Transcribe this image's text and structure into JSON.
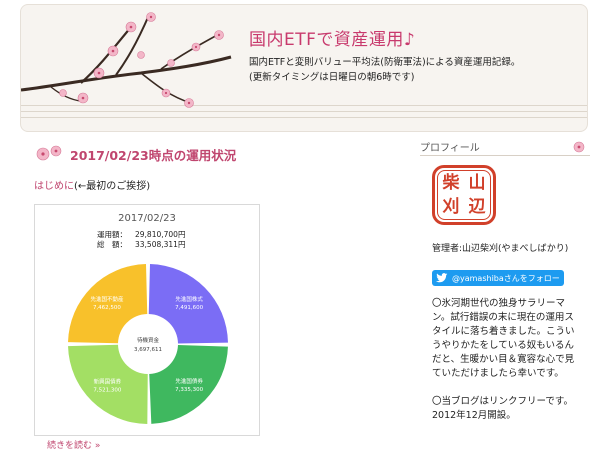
{
  "header": {
    "title": "国内ETFで資産運用♪",
    "desc1": "国内ETFと変則バリュー平均法(防衛軍法)による資産運用記録。",
    "desc2": "(更新タイミングは日曜日の朝6時です)"
  },
  "post": {
    "title": "2017/02/23時点の運用状況",
    "intro_link": "はじめに",
    "intro_rest": "(←最初のご挨拶)",
    "read_more": "続きを読む »"
  },
  "chart_data": {
    "type": "pie",
    "title": "2017/02/23",
    "summary": [
      {
        "label": "運用額：",
        "value": "29,810,700円"
      },
      {
        "label": "総　額：",
        "value": "33,508,311円"
      }
    ],
    "center_label": "待機資金",
    "center_value": "3,697,611",
    "categories": [
      "先進国株式",
      "先進国債券",
      "新興国債券",
      "先進国不動産"
    ],
    "values": [
      7491600,
      7335300,
      7521300,
      7462500
    ],
    "value_labels": [
      "7,491,600",
      "7,335,300",
      "7,521,300",
      "7,462,500"
    ],
    "colors": [
      "#7b6df5",
      "#3fb85f",
      "#a3df64",
      "#f8c12b"
    ]
  },
  "sidebar": {
    "heading": "プロフィール",
    "seal_chars": [
      "柴",
      "山",
      "刈",
      "辺"
    ],
    "admin": "管理者:山辺柴刈(やまべしばかり)",
    "twitter": "@yamashibaさんをフォロー",
    "profile1": "〇氷河期世代の独身サラリーマン。試行錯誤の末に現在の運用スタイルに落ち着きました。こういうやりかたをしている奴もいるんだと、生暖かい目＆寛容な心で見ていただけましたら幸いです。",
    "profile2": "〇当ブログはリンクフリーです。2012年12月開設。"
  }
}
